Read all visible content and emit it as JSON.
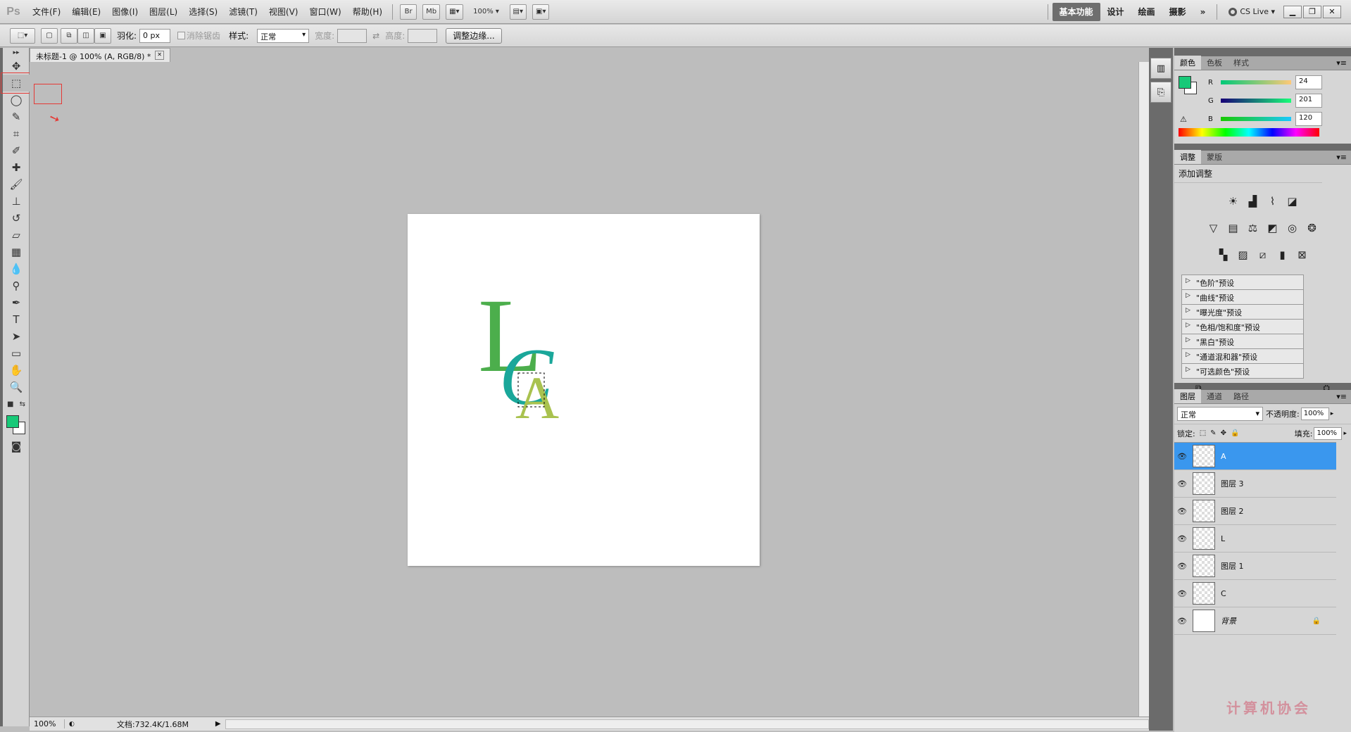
{
  "menubar": {
    "logo": "Ps",
    "menus": [
      "文件(F)",
      "编辑(E)",
      "图像(I)",
      "图层(L)",
      "选择(S)",
      "滤镜(T)",
      "视图(V)",
      "窗口(W)",
      "帮助(H)"
    ],
    "bridge": "Br",
    "minibridge": "Mb",
    "zoom": "100%",
    "workspaces": [
      "基本功能",
      "设计",
      "绘画",
      "摄影"
    ],
    "more": "»",
    "cslive": "CS Live"
  },
  "options": {
    "feather_label": "羽化:",
    "feather_value": "0 px",
    "antialias_label": "消除锯齿",
    "style_label": "样式:",
    "style_value": "正常",
    "width_label": "宽度:",
    "height_label": "高度:",
    "refine_edge": "调整边缘..."
  },
  "document": {
    "tab_title": "未标题-1 @ 100% (A, RGB/8) *",
    "zoom": "100%",
    "doc_info": "文档:732.4K/1.68M"
  },
  "colors": {
    "foreground": "#18c978",
    "background": "#ffffff",
    "letter_L": "#4cae4c",
    "letter_C": "#1aa79a",
    "letter_A": "#a9c24f",
    "selection_highlight": "#e53935"
  },
  "artwork": {
    "letter_L": "L",
    "letter_C": "C",
    "letter_A": "A"
  },
  "color_panel": {
    "tabs": [
      "颜色",
      "色板",
      "样式"
    ],
    "r_label": "R",
    "g_label": "G",
    "b_label": "B",
    "r": "24",
    "g": "201",
    "b": "120"
  },
  "adjust_panel": {
    "tabs": [
      "调整",
      "蒙版"
    ],
    "title": "添加调整",
    "presets": [
      "\"色阶\"预设",
      "\"曲线\"预设",
      "\"曝光度\"预设",
      "\"色相/饱和度\"预设",
      "\"黑白\"预设",
      "\"通道混和器\"预设",
      "\"可选颜色\"预设"
    ]
  },
  "layers_panel": {
    "tabs": [
      "图层",
      "通道",
      "路径"
    ],
    "blend_mode": "正常",
    "opacity_label": "不透明度:",
    "opacity": "100%",
    "lock_label": "锁定:",
    "fill_label": "填充:",
    "fill": "100%",
    "layers": [
      {
        "name": "A"
      },
      {
        "name": "图层 3"
      },
      {
        "name": "图层 2"
      },
      {
        "name": "L"
      },
      {
        "name": "图层 1"
      },
      {
        "name": "C"
      },
      {
        "name": "背景"
      }
    ]
  },
  "watermark": "计算机协会"
}
